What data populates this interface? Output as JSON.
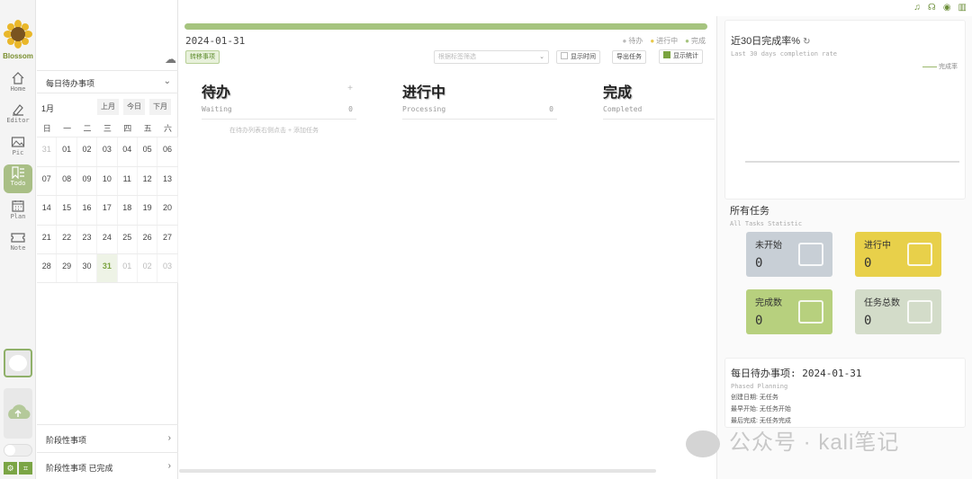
{
  "app": {
    "logo_text": "Blossom"
  },
  "nav": [
    {
      "label": "Home",
      "icon": "home-icon"
    },
    {
      "label": "Editor",
      "icon": "editor-icon"
    },
    {
      "label": "Pic",
      "icon": "picture-icon"
    },
    {
      "label": "Todo",
      "icon": "todo-icon",
      "active": true
    },
    {
      "label": "Plan",
      "icon": "calendar-icon"
    },
    {
      "label": "Note",
      "icon": "ticket-icon"
    }
  ],
  "calendar_panel": {
    "daily_todo": "每日待办事项",
    "month": "1月",
    "prev_month": "上月",
    "today": "今日",
    "next_month": "下月",
    "weekdays": [
      "日",
      "一",
      "二",
      "三",
      "四",
      "五",
      "六"
    ],
    "weeks": [
      [
        "31",
        "01",
        "02",
        "03",
        "04",
        "05",
        "06"
      ],
      [
        "07",
        "08",
        "09",
        "10",
        "11",
        "12",
        "13"
      ],
      [
        "14",
        "15",
        "16",
        "17",
        "18",
        "19",
        "20"
      ],
      [
        "21",
        "22",
        "23",
        "24",
        "25",
        "26",
        "27"
      ],
      [
        "28",
        "29",
        "30",
        "31",
        "01",
        "02",
        "03"
      ]
    ],
    "phase_items": [
      "阶段性事项",
      "阶段性事项  已完成"
    ]
  },
  "board": {
    "date": "2024-01-31",
    "legend": {
      "todo": "待办",
      "doing": "进行中",
      "done": "完成"
    },
    "toolbar": {
      "transfer": "转移事项",
      "filter_placeholder": "根据标签筛选",
      "show_time": "显示时间",
      "export": "导出任务",
      "show_stats": "显示统计"
    },
    "columns": [
      {
        "title": "待办",
        "subtitle": "Waiting",
        "count": "0"
      },
      {
        "title": "进行中",
        "subtitle": "Processing",
        "count": "0"
      },
      {
        "title": "完成",
        "subtitle": "Completed",
        "count": ""
      }
    ],
    "empty_hint": "在待办列表右侧点击 + 添加任务"
  },
  "stats": {
    "rate_title": "近30日完成率%",
    "rate_subtitle": "Last 30 days completion rate",
    "rate_legend": "完成率",
    "all_title": "所有任务",
    "all_subtitle": "All Tasks Statistic",
    "cards": [
      {
        "label": "未开始",
        "value": "0",
        "color": "#c8cfd6"
      },
      {
        "label": "进行中",
        "value": "0",
        "color": "#e8d04a"
      },
      {
        "label": "完成数",
        "value": "0",
        "color": "#b7d07e"
      },
      {
        "label": "任务总数",
        "value": "0",
        "color": "#d3dcc9"
      }
    ]
  },
  "detail": {
    "title": "每日待办事项: 2024-01-31",
    "subtitle": "Phased Planning",
    "created": "创建日期: 无任务",
    "earliest": "最早开始: 无任务开始",
    "latest": "最后完成: 无任务完成"
  },
  "watermark": "公众号 · kali笔记"
}
